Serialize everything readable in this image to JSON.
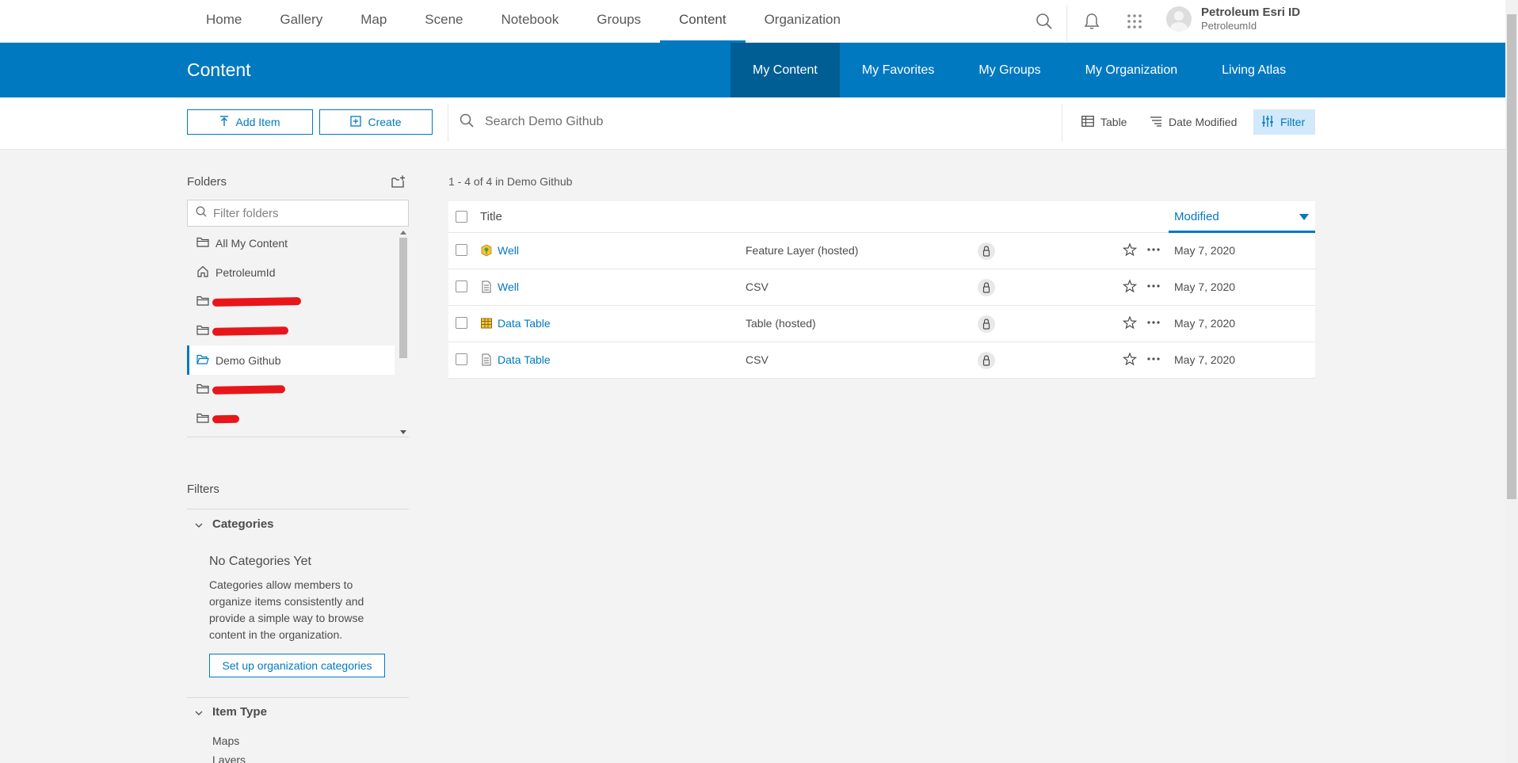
{
  "topnav": {
    "links": [
      "Home",
      "Gallery",
      "Map",
      "Scene",
      "Notebook",
      "Groups",
      "Content",
      "Organization"
    ],
    "active": "Content",
    "user": {
      "name": "Petroleum Esri ID",
      "username": "PetroleumId"
    }
  },
  "header": {
    "title": "Content",
    "tabs": [
      "My Content",
      "My Favorites",
      "My Groups",
      "My Organization",
      "Living Atlas"
    ],
    "active_tab": "My Content"
  },
  "toolbar": {
    "add_item": "Add Item",
    "create": "Create",
    "search_placeholder": "Search Demo Github",
    "view": "Table",
    "sort": "Date Modified",
    "filter": "Filter"
  },
  "folders": {
    "title": "Folders",
    "filter_placeholder": "Filter folders",
    "items": [
      {
        "label": "All My Content",
        "icon": "folder-icon"
      },
      {
        "label": "PetroleumId",
        "icon": "home-icon"
      },
      {
        "label": "",
        "icon": "folder-icon",
        "redacted": true
      },
      {
        "label": "",
        "icon": "folder-icon",
        "redacted": true
      },
      {
        "label": "Demo Github",
        "icon": "folder-open-icon",
        "active": true
      },
      {
        "label": "",
        "icon": "folder-icon",
        "redacted": true
      },
      {
        "label": "",
        "icon": "folder-icon",
        "redacted": true
      }
    ]
  },
  "filters": {
    "title": "Filters",
    "categories": {
      "title": "Categories",
      "empty_title": "No Categories Yet",
      "description": "Categories allow members to organize items consistently and provide a simple way to browse content in the organization.",
      "setup_button": "Set up organization categories"
    },
    "item_type": {
      "title": "Item Type",
      "options": [
        "Maps",
        "Layers"
      ]
    }
  },
  "results": {
    "count_text": "1 - 4 of 4 in Demo Github",
    "columns": {
      "title": "Title",
      "modified": "Modified"
    },
    "rows": [
      {
        "title": "Well",
        "type": "Feature Layer (hosted)",
        "date": "May 7, 2020",
        "icon": "feature-layer-icon"
      },
      {
        "title": "Well",
        "type": "CSV",
        "date": "May 7, 2020",
        "icon": "csv-file-icon"
      },
      {
        "title": "Data Table",
        "type": "Table (hosted)",
        "date": "May 7, 2020",
        "icon": "table-icon"
      },
      {
        "title": "Data Table",
        "type": "CSV",
        "date": "May 7, 2020",
        "icon": "csv-file-icon"
      }
    ]
  },
  "colors": {
    "accent": "#0079c1",
    "accent_dark": "#005e95",
    "redaction": "#e8161b",
    "background": "#f3f3f3"
  }
}
